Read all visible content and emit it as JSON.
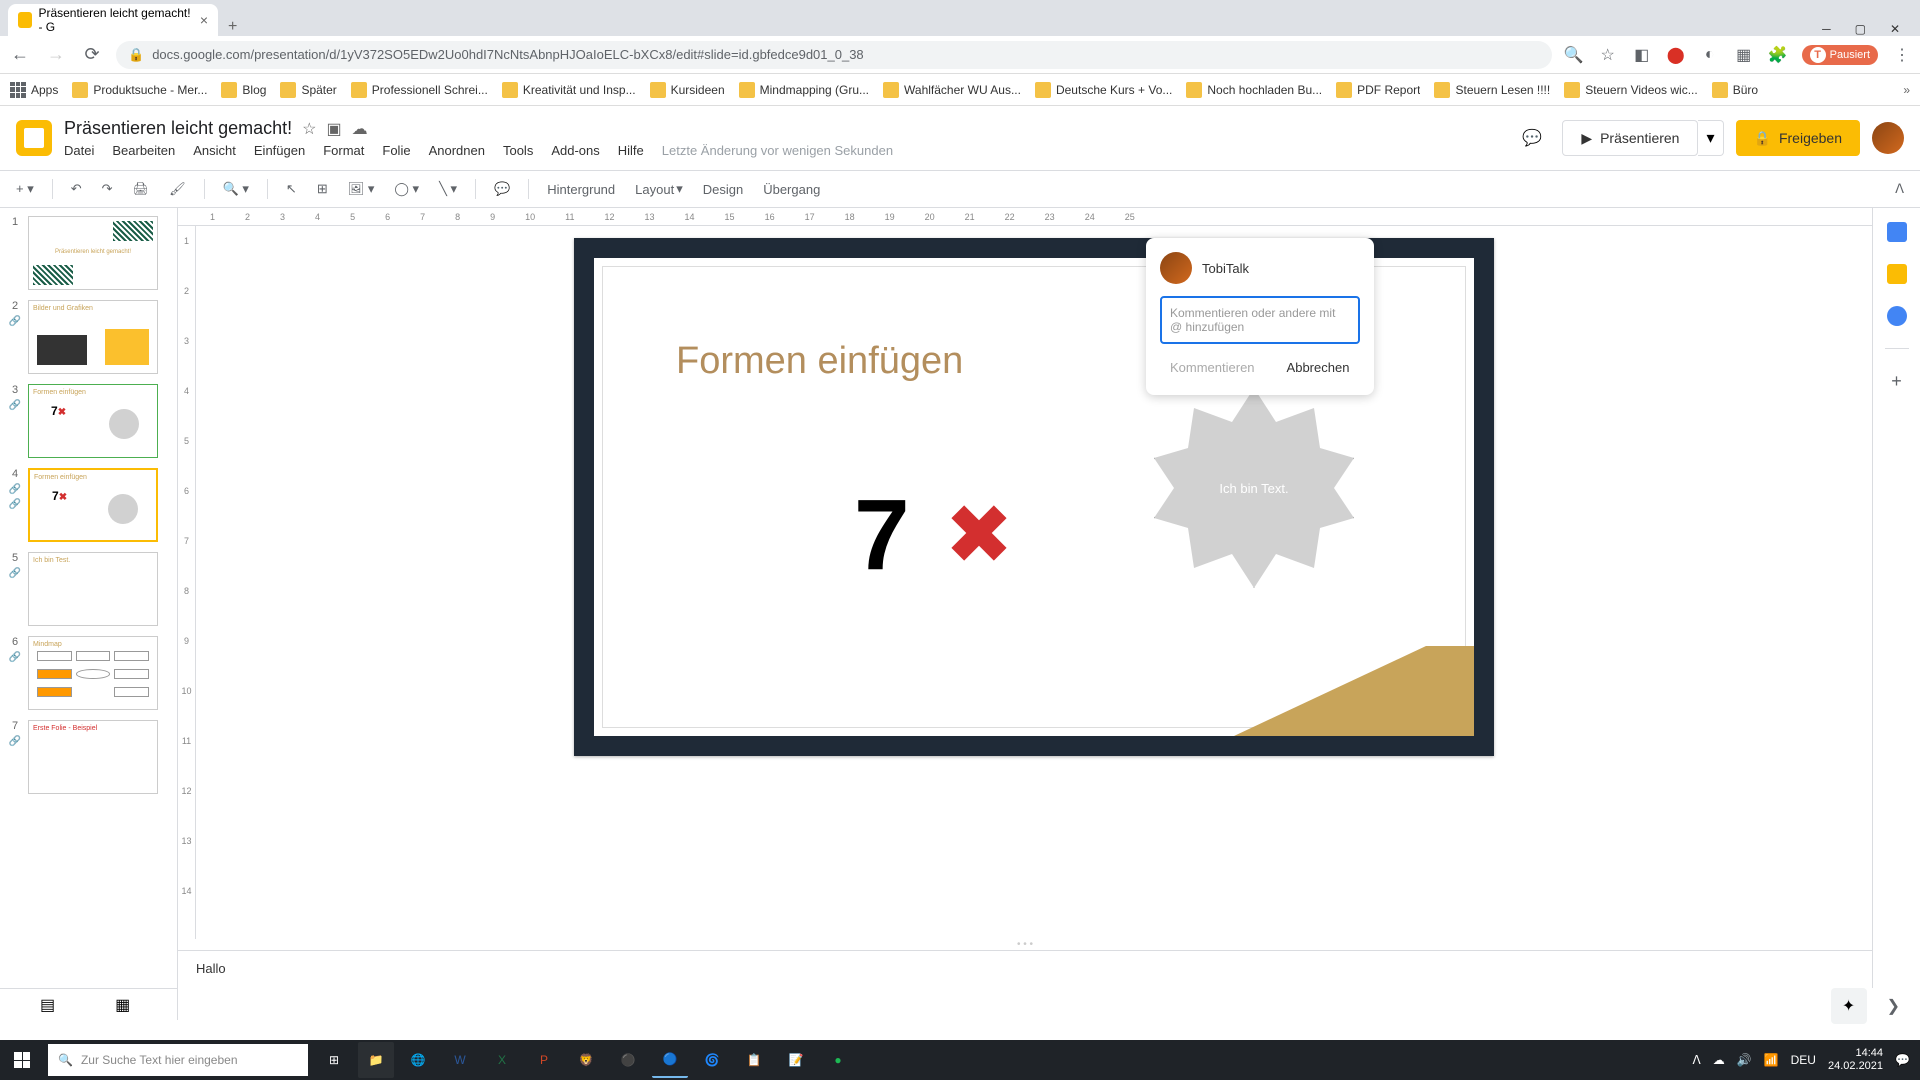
{
  "browser": {
    "tab_title": "Präsentieren leicht gemacht! - G",
    "url": "docs.google.com/presentation/d/1yV372SO5EDw2Uo0hdI7NcNtsAbnpHJOaIoELC-bXCx8/edit#slide=id.gbfedce9d01_0_38",
    "profile_status": "Pausiert"
  },
  "bookmarks": [
    "Apps",
    "Produktsuche - Mer...",
    "Blog",
    "Später",
    "Professionell Schrei...",
    "Kreativität und Insp...",
    "Kursideen",
    "Mindmapping  (Gru...",
    "Wahlfächer WU Aus...",
    "Deutsche Kurs + Vo...",
    "Noch hochladen Bu...",
    "PDF Report",
    "Steuern Lesen !!!!",
    "Steuern Videos wic...",
    "Büro"
  ],
  "app": {
    "doc_title": "Präsentieren leicht gemacht!",
    "menus": [
      "Datei",
      "Bearbeiten",
      "Ansicht",
      "Einfügen",
      "Format",
      "Folie",
      "Anordnen",
      "Tools",
      "Add-ons",
      "Hilfe"
    ],
    "save_status": "Letzte Änderung vor wenigen Sekunden",
    "present_label": "Präsentieren",
    "share_label": "Freigeben"
  },
  "toolbar": {
    "background": "Hintergrund",
    "layout": "Layout",
    "design": "Design",
    "transition": "Übergang"
  },
  "slides": [
    {
      "num": "1",
      "title": "Präsentieren leicht gemacht!"
    },
    {
      "num": "2",
      "title": "Bilder und Grafiken"
    },
    {
      "num": "3",
      "title": "Formen einfügen"
    },
    {
      "num": "4",
      "title": "Formen einfügen"
    },
    {
      "num": "5",
      "title": "Ich bin Test."
    },
    {
      "num": "6",
      "title": "Mindmap"
    },
    {
      "num": "7",
      "title": "Erste Folie - Beispiel"
    }
  ],
  "current_slide": {
    "title": "Formen einfügen",
    "shape_text": "Ich bin Text.",
    "seven": "7"
  },
  "speaker_notes": "Hallo",
  "comment": {
    "username": "TobiTalk",
    "placeholder": "Kommentieren oder andere mit @ hinzufügen",
    "submit": "Kommentieren",
    "cancel": "Abbrechen"
  },
  "ruler_h": [
    "1",
    "2",
    "3",
    "4",
    "5",
    "6",
    "7",
    "8",
    "9",
    "10",
    "11",
    "12",
    "13",
    "14",
    "15",
    "16",
    "17",
    "18",
    "19",
    "20",
    "21",
    "22",
    "23",
    "24",
    "25"
  ],
  "ruler_v": [
    "1",
    "2",
    "3",
    "4",
    "5",
    "6",
    "7",
    "8",
    "9",
    "10",
    "11",
    "12",
    "13",
    "14"
  ],
  "taskbar": {
    "search_placeholder": "Zur Suche Text hier eingeben",
    "lang": "DEU",
    "time": "14:44",
    "date": "24.02.2021"
  }
}
